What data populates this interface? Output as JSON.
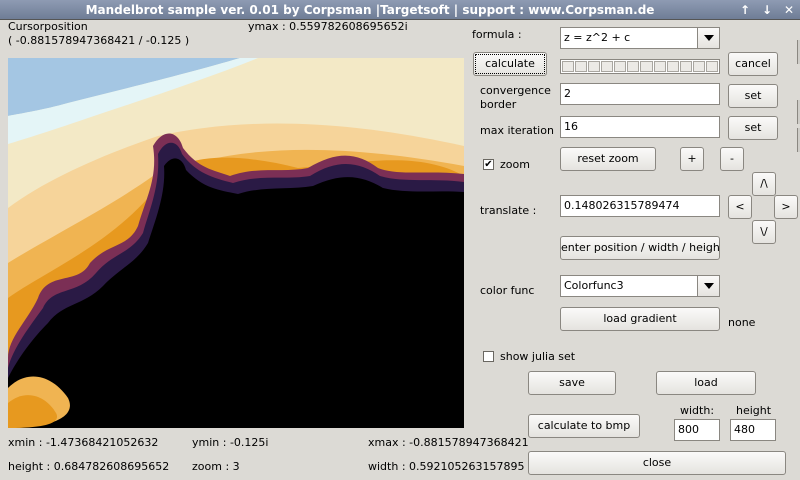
{
  "window": {
    "title": "Mandelbrot sample ver. 0.01 by Corpsman |Targetsoft | support : www.Corpsman.de"
  },
  "cursor": {
    "label": "Cursorposition",
    "value": "( -0.881578947368421 / -0.125 )"
  },
  "ymax": "ymax : 0.559782608695652i",
  "bottom": {
    "xmin": "xmin : -1.47368421052632",
    "ymin": "ymin : -0.125i",
    "xmax": "xmax : -0.881578947368421",
    "height": "height : 0.684782608695652",
    "zoom": "zoom : 3",
    "width": "width : 0.592105263157895"
  },
  "formula": {
    "label": "formula :",
    "value": "z = z^2 + c"
  },
  "buttons": {
    "calculate": "calculate",
    "cancel": "cancel",
    "set1": "set",
    "set2": "set",
    "reset_zoom": "reset zoom",
    "plus": "+",
    "minus": "-",
    "up": "/\\",
    "left": "<",
    "right": ">",
    "down": "\\/",
    "enter_position": "enter position / width / height",
    "load_gradient": "load gradient",
    "save": "save",
    "load": "load",
    "calc_bmp": "calculate to bmp",
    "close": "close"
  },
  "convergence": {
    "label1": "convergence",
    "label2": "border",
    "value": "2"
  },
  "max_iteration": {
    "label": "max iteration",
    "value": "16"
  },
  "zoom_check": {
    "label": "zoom",
    "checked": true
  },
  "translate": {
    "label": "translate :",
    "value": "0.148026315789474"
  },
  "color_func": {
    "label": "color func",
    "value": "Colorfunc3"
  },
  "gradient_status": "none",
  "julia": {
    "label": "show julia set",
    "checked": false
  },
  "bmp": {
    "width_label": "width:",
    "height_label": "height",
    "width_value": "800",
    "height_value": "480"
  },
  "progress": {
    "segments": 12,
    "filled": 0
  }
}
